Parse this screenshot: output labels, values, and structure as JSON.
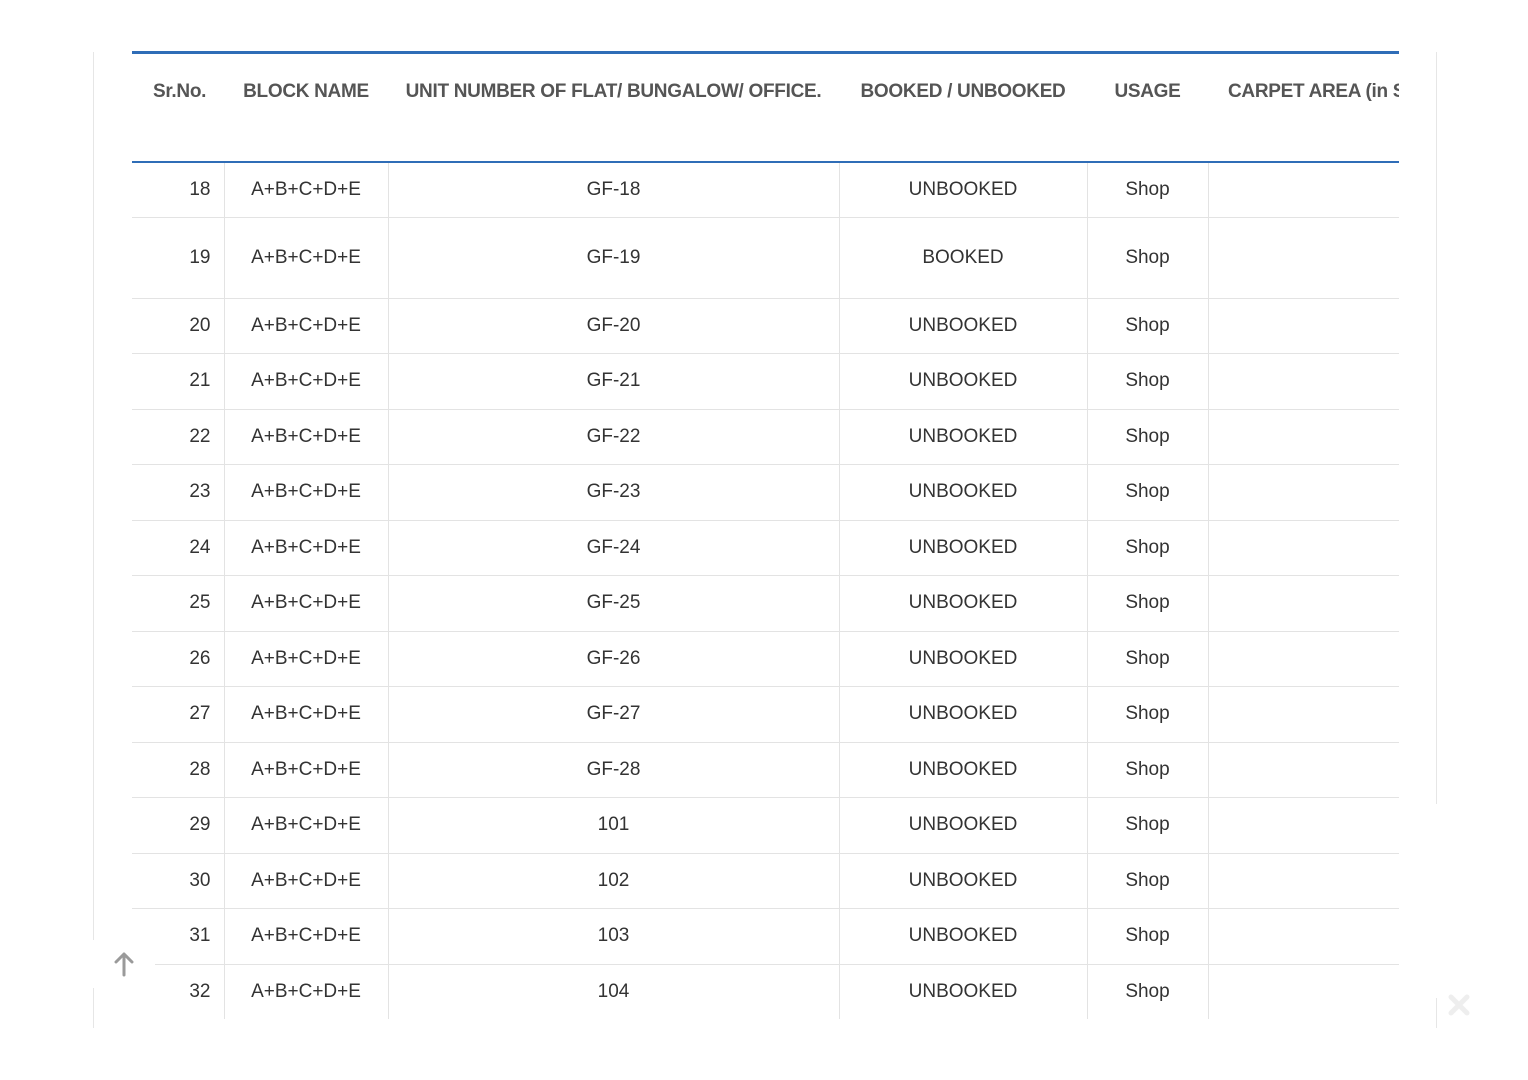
{
  "table": {
    "headers": [
      "Sr.No.",
      "BLOCK NAME",
      "UNIT NUMBER OF FLAT/ BUNGALOW/ OFFICE.",
      "BOOKED / UNBOOKED",
      "USAGE",
      "CARPET AREA (in Sq"
    ],
    "rows": [
      {
        "sr": "18",
        "block": "A+B+C+D+E",
        "unit": "GF-18",
        "status": "UNBOOKED",
        "usage": "Shop",
        "carpet": ""
      },
      {
        "sr": "19",
        "block": "A+B+C+D+E",
        "unit": "GF-19",
        "status": "BOOKED",
        "usage": "Shop",
        "carpet": ""
      },
      {
        "sr": "20",
        "block": "A+B+C+D+E",
        "unit": "GF-20",
        "status": "UNBOOKED",
        "usage": "Shop",
        "carpet": ""
      },
      {
        "sr": "21",
        "block": "A+B+C+D+E",
        "unit": "GF-21",
        "status": "UNBOOKED",
        "usage": "Shop",
        "carpet": ""
      },
      {
        "sr": "22",
        "block": "A+B+C+D+E",
        "unit": "GF-22",
        "status": "UNBOOKED",
        "usage": "Shop",
        "carpet": ""
      },
      {
        "sr": "23",
        "block": "A+B+C+D+E",
        "unit": "GF-23",
        "status": "UNBOOKED",
        "usage": "Shop",
        "carpet": ""
      },
      {
        "sr": "24",
        "block": "A+B+C+D+E",
        "unit": "GF-24",
        "status": "UNBOOKED",
        "usage": "Shop",
        "carpet": ""
      },
      {
        "sr": "25",
        "block": "A+B+C+D+E",
        "unit": "GF-25",
        "status": "UNBOOKED",
        "usage": "Shop",
        "carpet": ""
      },
      {
        "sr": "26",
        "block": "A+B+C+D+E",
        "unit": "GF-26",
        "status": "UNBOOKED",
        "usage": "Shop",
        "carpet": ""
      },
      {
        "sr": "27",
        "block": "A+B+C+D+E",
        "unit": "GF-27",
        "status": "UNBOOKED",
        "usage": "Shop",
        "carpet": ""
      },
      {
        "sr": "28",
        "block": "A+B+C+D+E",
        "unit": "GF-28",
        "status": "UNBOOKED",
        "usage": "Shop",
        "carpet": ""
      },
      {
        "sr": "29",
        "block": "A+B+C+D+E",
        "unit": "101",
        "status": "UNBOOKED",
        "usage": "Shop",
        "carpet": ""
      },
      {
        "sr": "30",
        "block": "A+B+C+D+E",
        "unit": "102",
        "status": "UNBOOKED",
        "usage": "Shop",
        "carpet": ""
      },
      {
        "sr": "31",
        "block": "A+B+C+D+E",
        "unit": "103",
        "status": "UNBOOKED",
        "usage": "Shop",
        "carpet": ""
      },
      {
        "sr": "32",
        "block": "A+B+C+D+E",
        "unit": "104",
        "status": "UNBOOKED",
        "usage": "Shop",
        "carpet": ""
      }
    ]
  },
  "controls": {
    "scroll_top_icon": "arrow-up-icon",
    "close_icon": "close-icon"
  }
}
